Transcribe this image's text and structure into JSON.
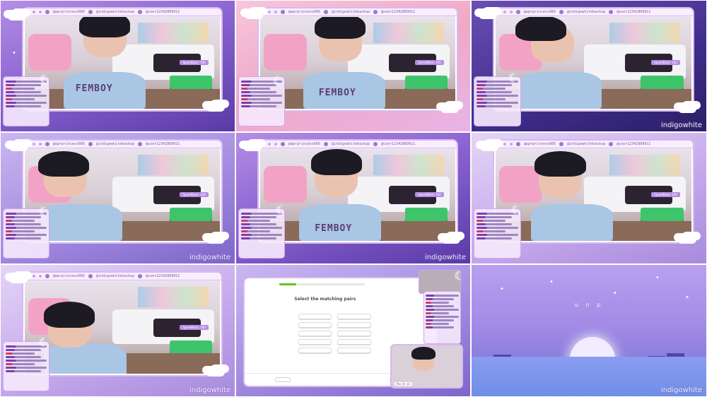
{
  "overlay": {
    "socials": [
      "@aprprincess666",
      "@indigowhitebackup",
      "@user12342869911"
    ],
    "speed_tag": "SpeedBack: 100",
    "watermark": "indigowhite"
  },
  "shirt_text": "FEMBOY",
  "quiz": {
    "title": "Select the matching pairs",
    "progress": 0.2,
    "pairs": [
      "",
      "",
      "",
      "",
      "",
      "",
      "",
      "",
      "",
      ""
    ],
    "skip_label": "",
    "check_label": "",
    "cam_label": "Pas de vie",
    "accent_color": "#58cc02"
  },
  "ending": {
    "text": "u n p",
    "watermark": "indigowhite"
  },
  "colors": {
    "frame": "#d7b9f0",
    "chat_bg": "#f5e8fc",
    "green_bag": "#3ec46b"
  }
}
